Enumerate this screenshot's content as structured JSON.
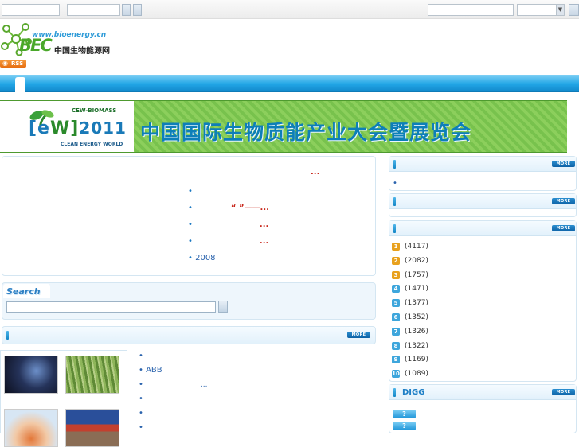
{
  "header": {
    "logo_url_text": "www.bioenergy.cn",
    "logo_mark": "BEC",
    "logo_name": "中国生物能源网",
    "rss_label": "RSS"
  },
  "banner": {
    "event_tag": "CEW-BIOMASS",
    "event_year": "2011",
    "event_sub": "CLEAN ENERGY WORLD",
    "title": "中国国际生物质能产业大会暨展览会"
  },
  "headlines": {
    "ellipsis_top": "...",
    "items": [
      {
        "bullet": "•",
        "text": ""
      },
      {
        "bullet": "•",
        "text": "“ ”——",
        "suffix": "..."
      },
      {
        "bullet": "•",
        "text": "",
        "suffix": "..."
      },
      {
        "bullet": "•",
        "text": "",
        "suffix": "..."
      },
      {
        "bullet": "•",
        "text": "2008",
        "suffix": ""
      }
    ]
  },
  "search": {
    "title": "Search",
    "placeholder": ""
  },
  "more_label": "MORE",
  "sidebar": {
    "bullet": "•",
    "digg_title": "DIGG",
    "rank_colors": [
      "#e8a11e",
      "#e8a11e",
      "#e8a11e",
      "#3ea6dc",
      "#3ea6dc",
      "#3ea6dc",
      "#3ea6dc",
      "#3ea6dc",
      "#3ea6dc",
      "#3ea6dc"
    ],
    "ranks": [
      {
        "num": "1",
        "count": "(4117)"
      },
      {
        "num": "2",
        "count": "(2082)"
      },
      {
        "num": "3",
        "count": "(1757)"
      },
      {
        "num": "4",
        "count": "(1471)"
      },
      {
        "num": "5",
        "count": "(1377)"
      },
      {
        "num": "6",
        "count": "(1352)"
      },
      {
        "num": "7",
        "count": "(1326)"
      },
      {
        "num": "8",
        "count": "(1322)"
      },
      {
        "num": "9",
        "count": "(1169)"
      },
      {
        "num": "10",
        "count": "(1089)"
      }
    ],
    "digg_buttons": [
      "?",
      "?"
    ]
  },
  "photo_list": {
    "items": [
      {
        "bullet": "•",
        "text": ""
      },
      {
        "bullet": "•",
        "text": "ABB"
      },
      {
        "bullet": "•",
        "text": "",
        "suffix": "..."
      },
      {
        "bullet": "•",
        "text": ""
      },
      {
        "bullet": "•",
        "text": ""
      },
      {
        "bullet": "•",
        "text": ""
      }
    ]
  },
  "colors": {
    "accent_blue": "#1a8fd6",
    "banner_green": "#7ac44f",
    "headline_red": "#c8261a"
  }
}
